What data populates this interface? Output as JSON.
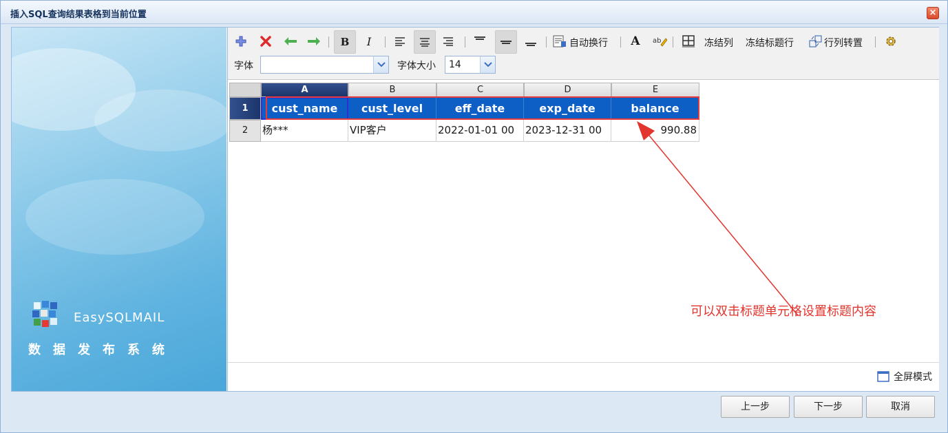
{
  "dialog": {
    "title": "插入SQL查询结果表格到当前位置",
    "close_label": "×"
  },
  "left_panel": {
    "brand": "EasySQLMAIL",
    "subtitle": "数据发布系统"
  },
  "toolbar": {
    "word_wrap_label": "自动换行",
    "freeze_col_label": "冻结列",
    "freeze_header_label": "冻结标题行",
    "transpose_label": "行列转置",
    "font_label": "字体",
    "font_value": "",
    "font_size_label": "字体大小",
    "font_size_value": "14",
    "icons": [
      "add-icon",
      "delete-icon",
      "arrow-left-icon",
      "arrow-right-icon",
      "bold-icon",
      "italic-icon",
      "align-left-icon",
      "align-center-icon",
      "align-right-icon",
      "valign-top-icon",
      "valign-middle-icon",
      "valign-bottom-icon",
      "wrap-icon",
      "font-color-icon",
      "highlight-icon",
      "border-icon",
      "transpose-icon",
      "settings-icon"
    ]
  },
  "grid": {
    "columns": [
      "A",
      "B",
      "C",
      "D",
      "E"
    ],
    "rows": [
      "1",
      "2"
    ],
    "header_row": [
      "cust_name",
      "cust_level",
      "eff_date",
      "exp_date",
      "balance"
    ],
    "data_row": [
      "杨***",
      "VIP客户",
      "2022-01-01 00",
      "2023-12-31 00",
      "990.88"
    ]
  },
  "annotation": "可以双击标题单元格设置标题内容",
  "fullscreen_label": "全屏模式",
  "footer": {
    "prev": "上一步",
    "next": "下一步",
    "cancel": "取消"
  },
  "colors": {
    "header_blue": "#0d5fc6",
    "annotation_red": "#e2352e"
  }
}
